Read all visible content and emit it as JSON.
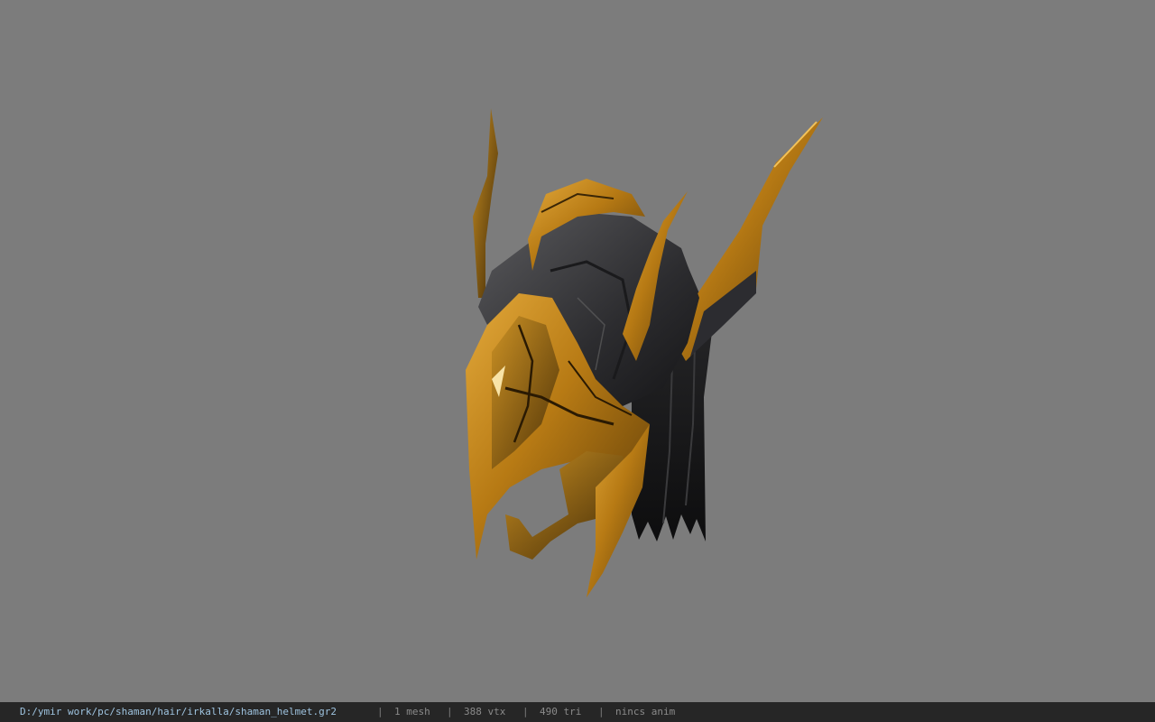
{
  "viewport": {
    "background_color": "#7c7c7c",
    "model_description_icon": "helmet-model"
  },
  "status_bar": {
    "file_path": "D:/ymir work/pc/shaman/hair/irkalla/shaman_helmet.gr2",
    "separator": "|",
    "mesh_count": "1 mesh",
    "vertex_count": "388 vtx",
    "triangle_count": "490 tri",
    "anim_status": "nincs anim",
    "path_color": "#9ec3df",
    "text_color": "#8a8a8a",
    "background_color": "#262626"
  }
}
